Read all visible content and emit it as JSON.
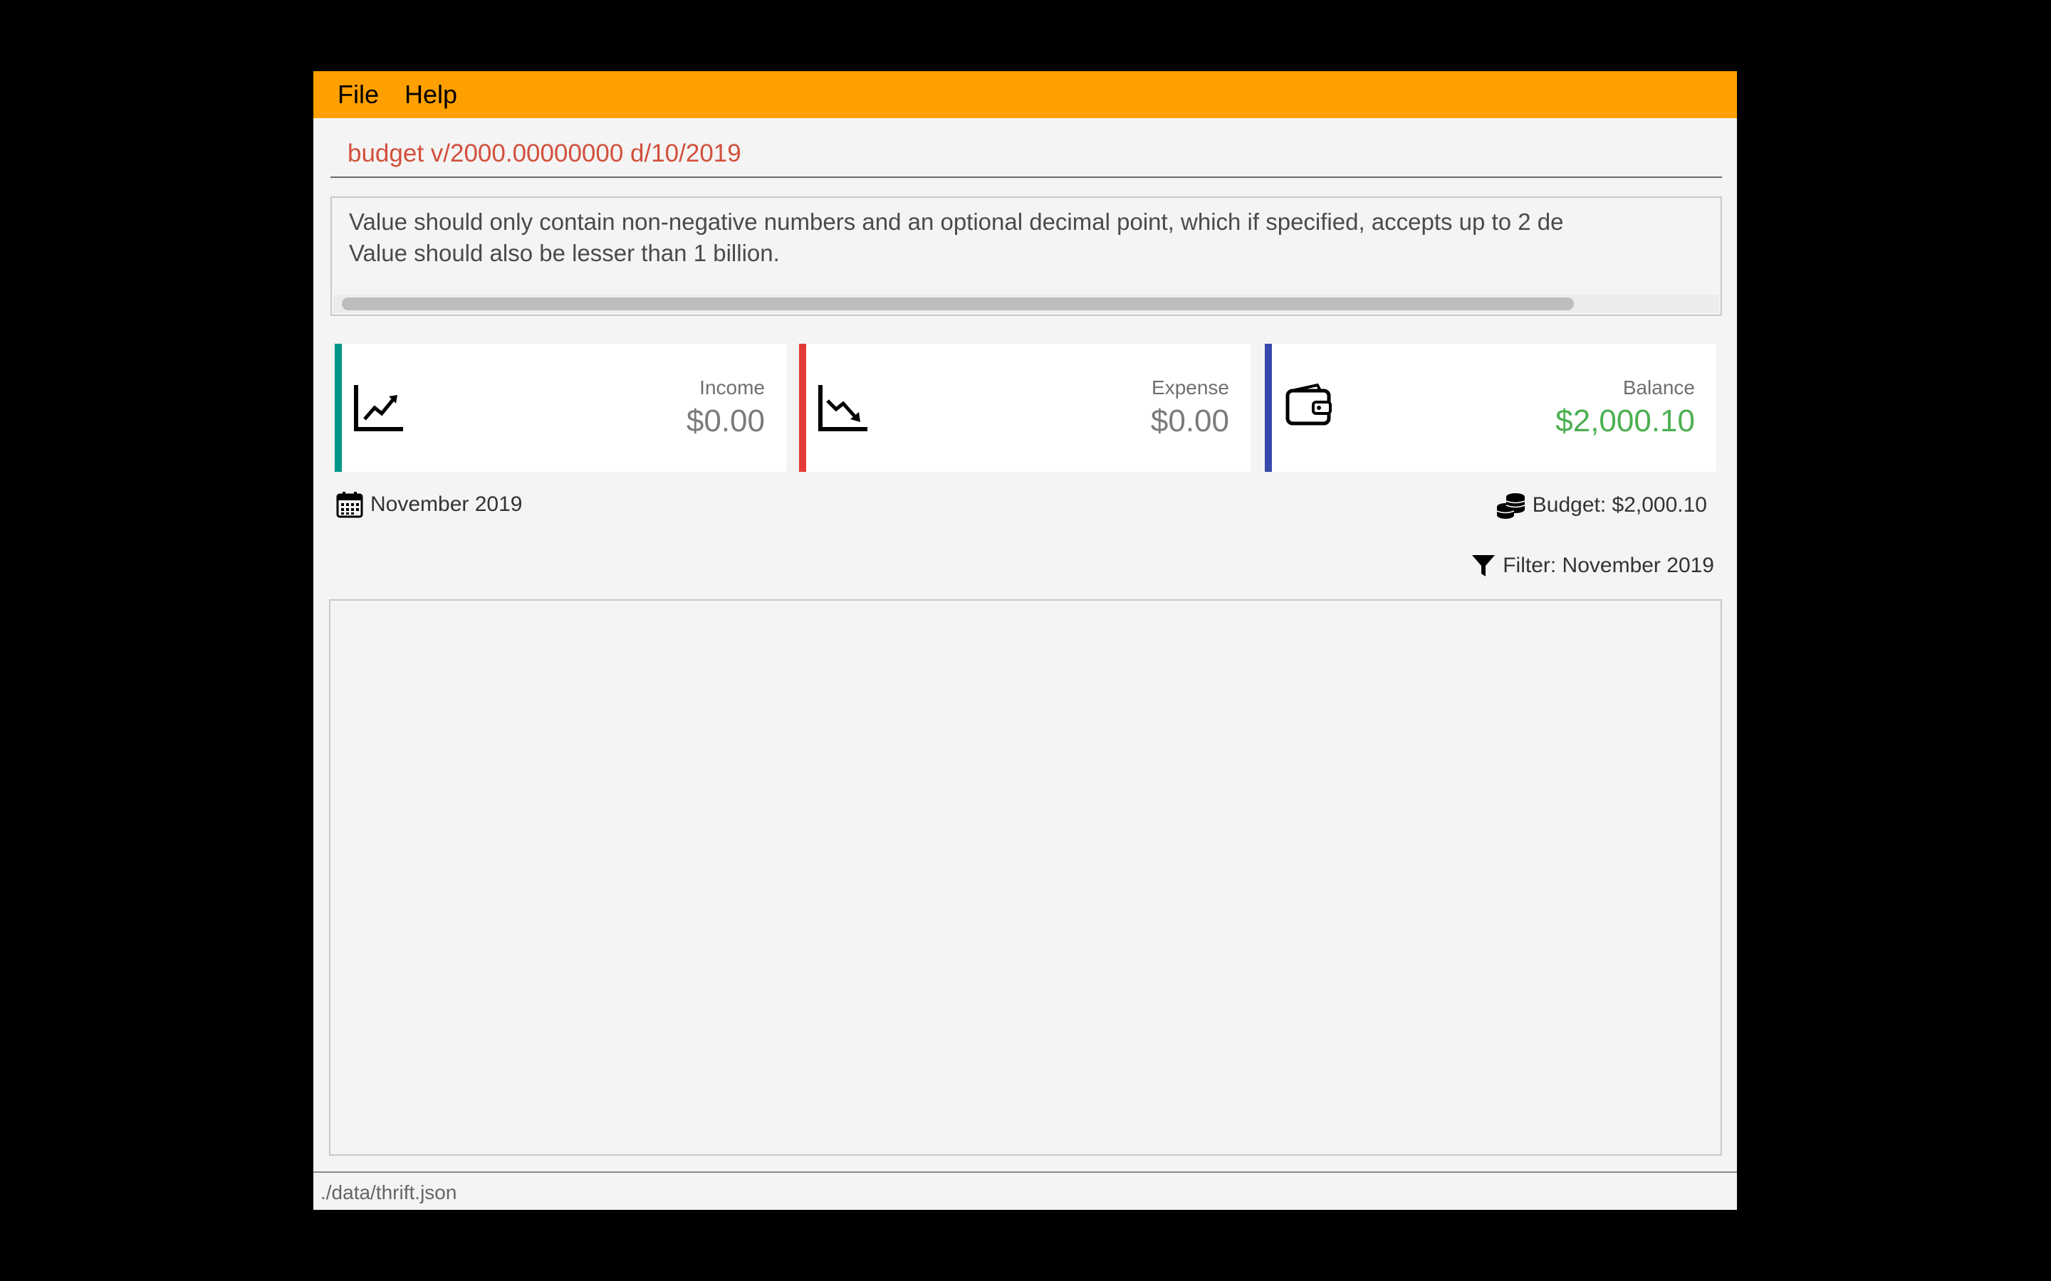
{
  "menu": {
    "file_label": "File",
    "help_label": "Help"
  },
  "command": {
    "value": "budget v/2000.00000000 d/10/2019"
  },
  "result": {
    "line1": "Value should only contain non-negative numbers and an optional decimal point, which if specified, accepts up to 2 de",
    "line2": "Value should also be lesser than 1 billion."
  },
  "summary": {
    "income": {
      "label": "Income",
      "amount": "$0.00",
      "icon": "trending-up-chart-icon",
      "accent": "#009688"
    },
    "expense": {
      "label": "Expense",
      "amount": "$0.00",
      "icon": "trending-down-chart-icon",
      "accent": "#e53935"
    },
    "balance": {
      "label": "Balance",
      "amount": "$2,000.10",
      "icon": "wallet-icon",
      "accent": "#3949ab",
      "amount_color": "#4caf50"
    }
  },
  "period": {
    "label": "November 2019",
    "icon": "calendar-icon"
  },
  "budget": {
    "label": "Budget: $2,000.10",
    "icon": "coins-icon"
  },
  "filter": {
    "label": "Filter: November 2019",
    "icon": "filter-icon"
  },
  "status": {
    "file_path": "./data/thrift.json"
  },
  "colors": {
    "menubar": "#ffa000",
    "command_text": "#d2503c"
  }
}
